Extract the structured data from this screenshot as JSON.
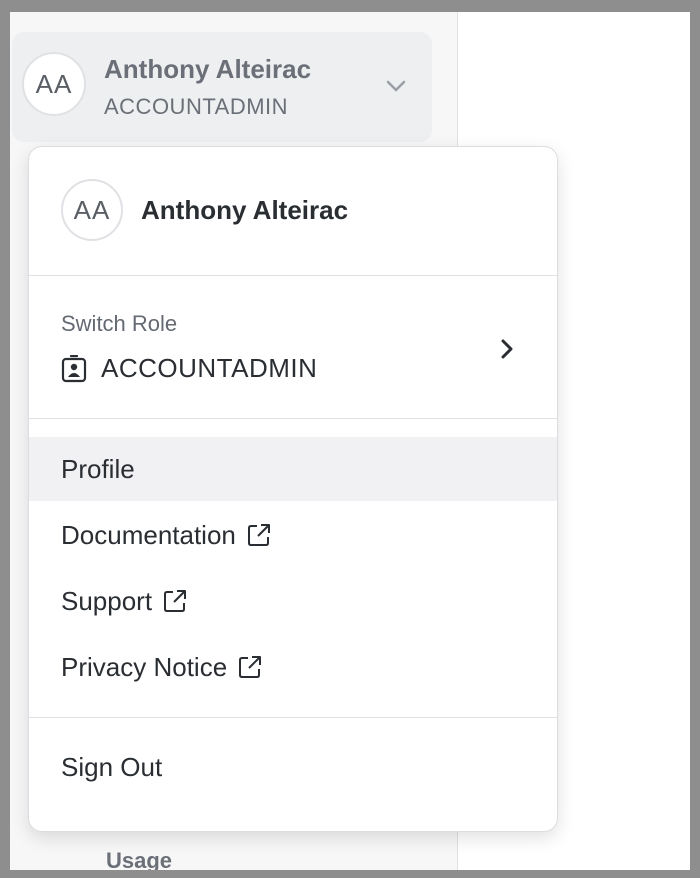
{
  "sidebar": {
    "user": {
      "initials": "AA",
      "name": "Anthony Alteirac",
      "role": "ACCOUNTADMIN",
      "chevron_icon": "chevron-down-icon"
    },
    "partial_item": "Usage"
  },
  "menu": {
    "avatar_initials": "AA",
    "name": "Anthony Alteirac",
    "switch_role": {
      "label": "Switch Role",
      "value": "ACCOUNTADMIN",
      "role_icon": "badge-icon",
      "arrow_icon": "chevron-right-icon"
    },
    "items": [
      {
        "label": "Profile",
        "external": false,
        "highlighted": true
      },
      {
        "label": "Documentation",
        "external": true
      },
      {
        "label": "Support",
        "external": true
      },
      {
        "label": "Privacy Notice",
        "external": true
      }
    ],
    "sign_out": "Sign Out"
  },
  "colors": {
    "outer_border": "#8e8e8e",
    "sidebar_bg": "#f7f7f8",
    "card_bg": "#eeeff1",
    "hover_bg": "#f1f1f3",
    "text_primary": "#2a2e33",
    "text_muted": "#6b7078"
  }
}
